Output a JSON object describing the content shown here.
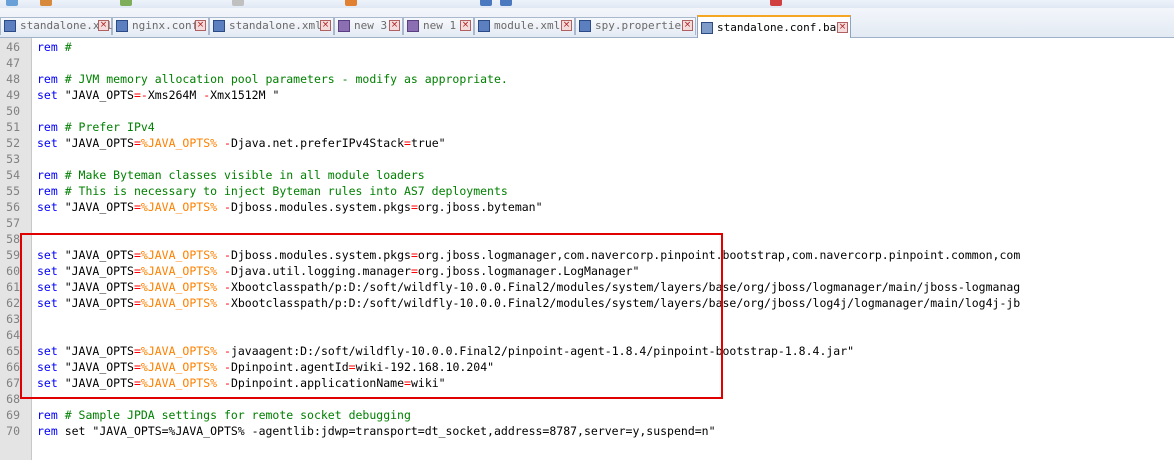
{
  "tabs": [
    {
      "label": "standalone.xml",
      "icon": "file-icon",
      "active": false
    },
    {
      "label": "nginx.conf",
      "icon": "file-icon",
      "active": false
    },
    {
      "label": "standalone.xml",
      "icon": "file-icon",
      "active": false
    },
    {
      "label": "new 3",
      "icon": "file-icon",
      "active": false
    },
    {
      "label": "new 1",
      "icon": "file-icon",
      "active": false
    },
    {
      "label": "module.xml",
      "icon": "file-icon",
      "active": false
    },
    {
      "label": "spy.properties",
      "icon": "file-icon",
      "active": false
    },
    {
      "label": "standalone.conf.bat",
      "icon": "file-icon",
      "active": true
    }
  ],
  "lines": [
    {
      "n": "46",
      "tokens": [
        [
          "kw",
          "rem"
        ],
        [
          "cm",
          " #"
        ]
      ]
    },
    {
      "n": "47",
      "tokens": []
    },
    {
      "n": "48",
      "tokens": [
        [
          "kw",
          "rem"
        ],
        [
          "cm",
          " # JVM memory allocation pool parameters - modify as appropriate."
        ]
      ]
    },
    {
      "n": "49",
      "tokens": [
        [
          "kw",
          "set"
        ],
        [
          "tx",
          " \"JAVA_OPTS"
        ],
        [
          "op",
          "=-"
        ],
        [
          "tx",
          "Xms264M "
        ],
        [
          "op",
          "-"
        ],
        [
          "tx",
          "Xmx1512M \""
        ]
      ]
    },
    {
      "n": "50",
      "tokens": []
    },
    {
      "n": "51",
      "tokens": [
        [
          "kw",
          "rem"
        ],
        [
          "cm",
          " # Prefer IPv4"
        ]
      ]
    },
    {
      "n": "52",
      "tokens": [
        [
          "kw",
          "set"
        ],
        [
          "tx",
          " \"JAVA_OPTS"
        ],
        [
          "op",
          "="
        ],
        [
          "var",
          "%JAVA_OPTS%"
        ],
        [
          "tx",
          " "
        ],
        [
          "op",
          "-"
        ],
        [
          "tx",
          "Djava.net.preferIPv4Stack"
        ],
        [
          "op",
          "="
        ],
        [
          "tx",
          "true\""
        ]
      ]
    },
    {
      "n": "53",
      "tokens": []
    },
    {
      "n": "54",
      "tokens": [
        [
          "kw",
          "rem"
        ],
        [
          "cm",
          " # Make Byteman classes visible in all module loaders"
        ]
      ]
    },
    {
      "n": "55",
      "tokens": [
        [
          "kw",
          "rem"
        ],
        [
          "cm",
          " # This is necessary to inject Byteman rules into AS7 deployments"
        ]
      ]
    },
    {
      "n": "56",
      "tokens": [
        [
          "kw",
          "set"
        ],
        [
          "tx",
          " \"JAVA_OPTS"
        ],
        [
          "op",
          "="
        ],
        [
          "var",
          "%JAVA_OPTS%"
        ],
        [
          "tx",
          " "
        ],
        [
          "op",
          "-"
        ],
        [
          "tx",
          "Djboss.modules.system.pkgs"
        ],
        [
          "op",
          "="
        ],
        [
          "tx",
          "org.jboss.byteman\""
        ]
      ]
    },
    {
      "n": "57",
      "tokens": []
    },
    {
      "n": "58",
      "tokens": []
    },
    {
      "n": "59",
      "tokens": [
        [
          "kw",
          "set"
        ],
        [
          "tx",
          " \"JAVA_OPTS"
        ],
        [
          "op",
          "="
        ],
        [
          "var",
          "%JAVA_OPTS%"
        ],
        [
          "tx",
          " "
        ],
        [
          "op",
          "-"
        ],
        [
          "tx",
          "Djboss.modules.system.pkgs"
        ],
        [
          "op",
          "="
        ],
        [
          "tx",
          "org.jboss.logmanager,com.navercorp.pinpoint.bootstrap,com.navercorp.pinpoint.common,com"
        ]
      ]
    },
    {
      "n": "60",
      "tokens": [
        [
          "kw",
          "set"
        ],
        [
          "tx",
          " \"JAVA_OPTS"
        ],
        [
          "op",
          "="
        ],
        [
          "var",
          "%JAVA_OPTS%"
        ],
        [
          "tx",
          " "
        ],
        [
          "op",
          "-"
        ],
        [
          "tx",
          "Djava.util.logging.manager"
        ],
        [
          "op",
          "="
        ],
        [
          "tx",
          "org.jboss.logmanager.LogManager\""
        ]
      ]
    },
    {
      "n": "61",
      "tokens": [
        [
          "kw",
          "set"
        ],
        [
          "tx",
          " \"JAVA_OPTS"
        ],
        [
          "op",
          "="
        ],
        [
          "var",
          "%JAVA_OPTS%"
        ],
        [
          "tx",
          " "
        ],
        [
          "op",
          "-"
        ],
        [
          "tx",
          "Xbootclasspath/p:D:/soft/wildfly-10.0.0.Final2/modules/system/layers/base/org/jboss/logmanager/main/jboss-logmanag"
        ]
      ]
    },
    {
      "n": "62",
      "tokens": [
        [
          "kw",
          "set"
        ],
        [
          "tx",
          " \"JAVA_OPTS"
        ],
        [
          "op",
          "="
        ],
        [
          "var",
          "%JAVA_OPTS%"
        ],
        [
          "tx",
          " "
        ],
        [
          "op",
          "-"
        ],
        [
          "tx",
          "Xbootclasspath/p:D:/soft/wildfly-10.0.0.Final2/modules/system/layers/base/org/jboss/log4j/logmanager/main/log4j-jb"
        ]
      ]
    },
    {
      "n": "63",
      "tokens": []
    },
    {
      "n": "64",
      "tokens": []
    },
    {
      "n": "65",
      "tokens": [
        [
          "kw",
          "set"
        ],
        [
          "tx",
          " \"JAVA_OPTS"
        ],
        [
          "op",
          "="
        ],
        [
          "var",
          "%JAVA_OPTS%"
        ],
        [
          "tx",
          " "
        ],
        [
          "op",
          "-"
        ],
        [
          "tx",
          "javaagent:D:/soft/wildfly-10.0.0.Final2/pinpoint-agent-1.8.4/pinpoint-bootstrap-1.8.4.jar\""
        ]
      ]
    },
    {
      "n": "66",
      "tokens": [
        [
          "kw",
          "set"
        ],
        [
          "tx",
          " \"JAVA_OPTS"
        ],
        [
          "op",
          "="
        ],
        [
          "var",
          "%JAVA_OPTS%"
        ],
        [
          "tx",
          " "
        ],
        [
          "op",
          "-"
        ],
        [
          "tx",
          "Dpinpoint.agentId"
        ],
        [
          "op",
          "="
        ],
        [
          "tx",
          "wiki-192.168.10.204\""
        ]
      ]
    },
    {
      "n": "67",
      "tokens": [
        [
          "kw",
          "set"
        ],
        [
          "tx",
          " \"JAVA_OPTS"
        ],
        [
          "op",
          "="
        ],
        [
          "var",
          "%JAVA_OPTS%"
        ],
        [
          "tx",
          " "
        ],
        [
          "op",
          "-"
        ],
        [
          "tx",
          "Dpinpoint.applicationName"
        ],
        [
          "op",
          "="
        ],
        [
          "tx",
          "wiki\""
        ]
      ]
    },
    {
      "n": "68",
      "tokens": []
    },
    {
      "n": "69",
      "tokens": [
        [
          "kw",
          "rem"
        ],
        [
          "cm",
          " # Sample JPDA settings for remote socket debugging"
        ]
      ]
    },
    {
      "n": "70",
      "tokens": [
        [
          "kw",
          "rem"
        ],
        [
          "tx",
          " set \"JAVA_OPTS=%JAVA_OPTS% -agentlib:jdwp=transport=dt_socket,address=8787,server=y,suspend=n\""
        ]
      ]
    }
  ],
  "colors": {
    "keyword": "#0000ff",
    "comment": "#008000",
    "operator": "#ff0000",
    "variable": "#ff8000",
    "highlight_box": "#e00000"
  }
}
